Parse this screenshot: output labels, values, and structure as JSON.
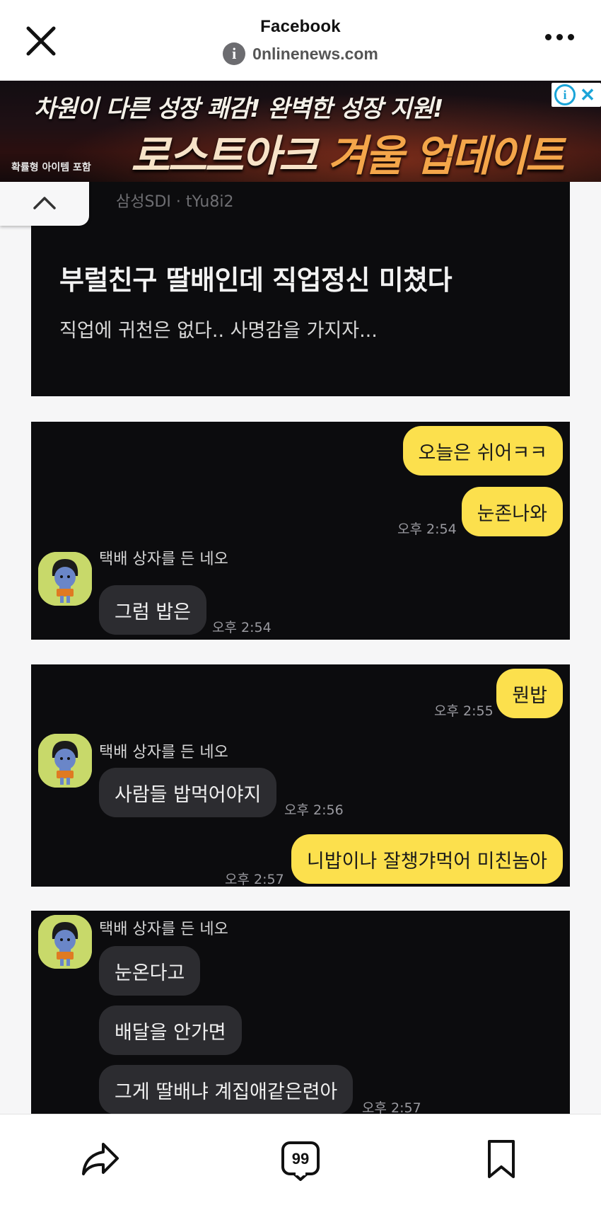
{
  "browser": {
    "title": "Facebook",
    "url": "0nlinenews.com"
  },
  "ad": {
    "tagline": "차원이 다른 성장 쾌감! 완벽한 성장 지원!",
    "headline_a": "로스트아크 ",
    "headline_b": "겨울 업데이트",
    "small_note": "확률형 아이템 포함",
    "info_glyph": "i",
    "close_glyph": "✕"
  },
  "post": {
    "meta": "삼성SDI · tYu8i2",
    "title": "부럴친구 딸배인데 직업정신 미쳤다",
    "subtitle": "직업에 귀천은 없다.. 사명감을 가지자..."
  },
  "chat1": {
    "me1": "오늘은 쉬어ㅋㅋ",
    "me2": "눈존나와",
    "me_time": "오후 2:54",
    "sender": "택배 상자를 든 네오",
    "other1": "그럼 밥은",
    "other_time": "오후 2:54"
  },
  "chat2": {
    "me1": "뭔밥",
    "me1_time": "오후 2:55",
    "sender": "택배 상자를 든 네오",
    "other1": "사람들 밥먹어야지",
    "other_time": "오후 2:56",
    "me2": "니밥이나 잘챙갸먹어 미친놈아",
    "me2_time": "오후 2:57"
  },
  "chat3": {
    "sender": "택배 상자를 든 네오",
    "other1": "눈온다고",
    "other2": "배달을 안가면",
    "other3": "그게 딸배냐 계집애같은련아",
    "other_time": "오후 2:57"
  },
  "bottom": {
    "quote_count": "99"
  },
  "colors": {
    "my_bubble": "#fce04d",
    "other_bubble": "#2c2c30",
    "chat_bg": "#0c0c0e",
    "avatar_bg": "#c8d96a",
    "ad_accent": "#1aa4d8"
  }
}
